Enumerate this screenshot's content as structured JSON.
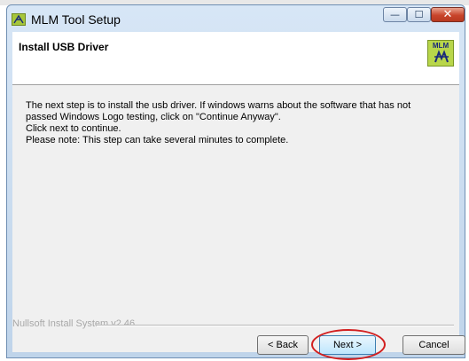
{
  "window": {
    "title": "MLM Tool Setup",
    "controls": {
      "minimize_glyph": "—",
      "maximize_glyph": "☐",
      "close_glyph": "✕"
    }
  },
  "header": {
    "title": "Install USB Driver",
    "logo_text": "MLM"
  },
  "body": {
    "lines": [
      "The next step is to install the usb driver. If windows warns about the software that has not",
      "passed Windows Logo testing, click on \"Continue Anyway\".",
      "Click next to continue.",
      "Please note: This step can take several minutes to complete."
    ]
  },
  "footer": {
    "branding": "Nullsoft Install System v2.46"
  },
  "buttons": {
    "back": "< Back",
    "next": "Next >",
    "cancel": "Cancel"
  },
  "colors": {
    "highlight": "#d21f1f",
    "logo_bg": "#b8d64a"
  }
}
